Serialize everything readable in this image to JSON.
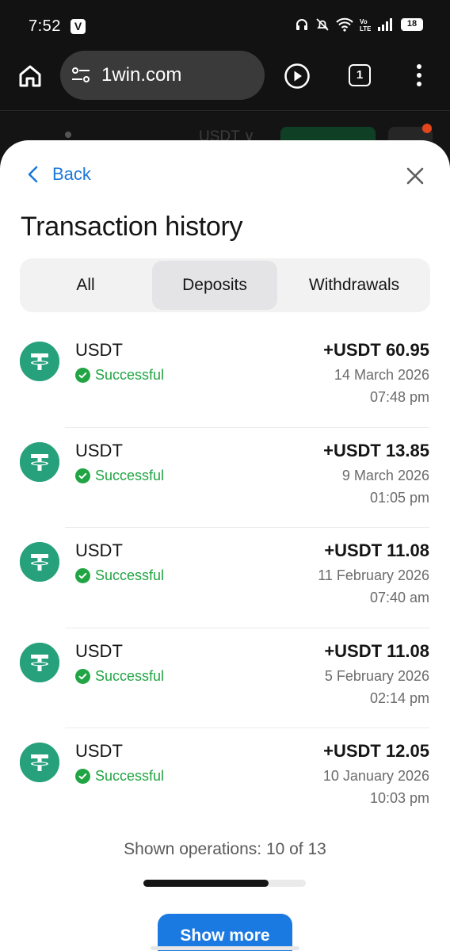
{
  "status_bar": {
    "time": "7:52",
    "v_badge": "V",
    "battery": "18"
  },
  "browser": {
    "url": "1win.com",
    "tab_count": "1"
  },
  "site_header": {
    "currency": "USDT ∨"
  },
  "sheet": {
    "back_label": "Back",
    "title": "Transaction history",
    "tabs": [
      {
        "label": "All",
        "selected": false
      },
      {
        "label": "Deposits",
        "selected": true
      },
      {
        "label": "Withdrawals",
        "selected": false
      }
    ],
    "transactions": [
      {
        "currency": "USDT",
        "status": "Successful",
        "amount": "+USDT 60.95",
        "date": "14 March 2026",
        "time": "07:48 pm"
      },
      {
        "currency": "USDT",
        "status": "Successful",
        "amount": "+USDT 13.85",
        "date": "9 March 2026",
        "time": "01:05 pm"
      },
      {
        "currency": "USDT",
        "status": "Successful",
        "amount": "+USDT 11.08",
        "date": "11 February 2026",
        "time": "07:40 am"
      },
      {
        "currency": "USDT",
        "status": "Successful",
        "amount": "+USDT 11.08",
        "date": "5 February 2026",
        "time": "02:14 pm"
      },
      {
        "currency": "USDT",
        "status": "Successful",
        "amount": "+USDT 12.05",
        "date": "10 January 2026",
        "time": "10:03 pm"
      }
    ],
    "shown_operations": "Shown operations: 10 of 13",
    "progress_fraction": 0.77,
    "show_more_label": "Show more"
  },
  "colors": {
    "accent": "#1b7ae2",
    "success": "#21a544",
    "tether": "#26a17b"
  }
}
